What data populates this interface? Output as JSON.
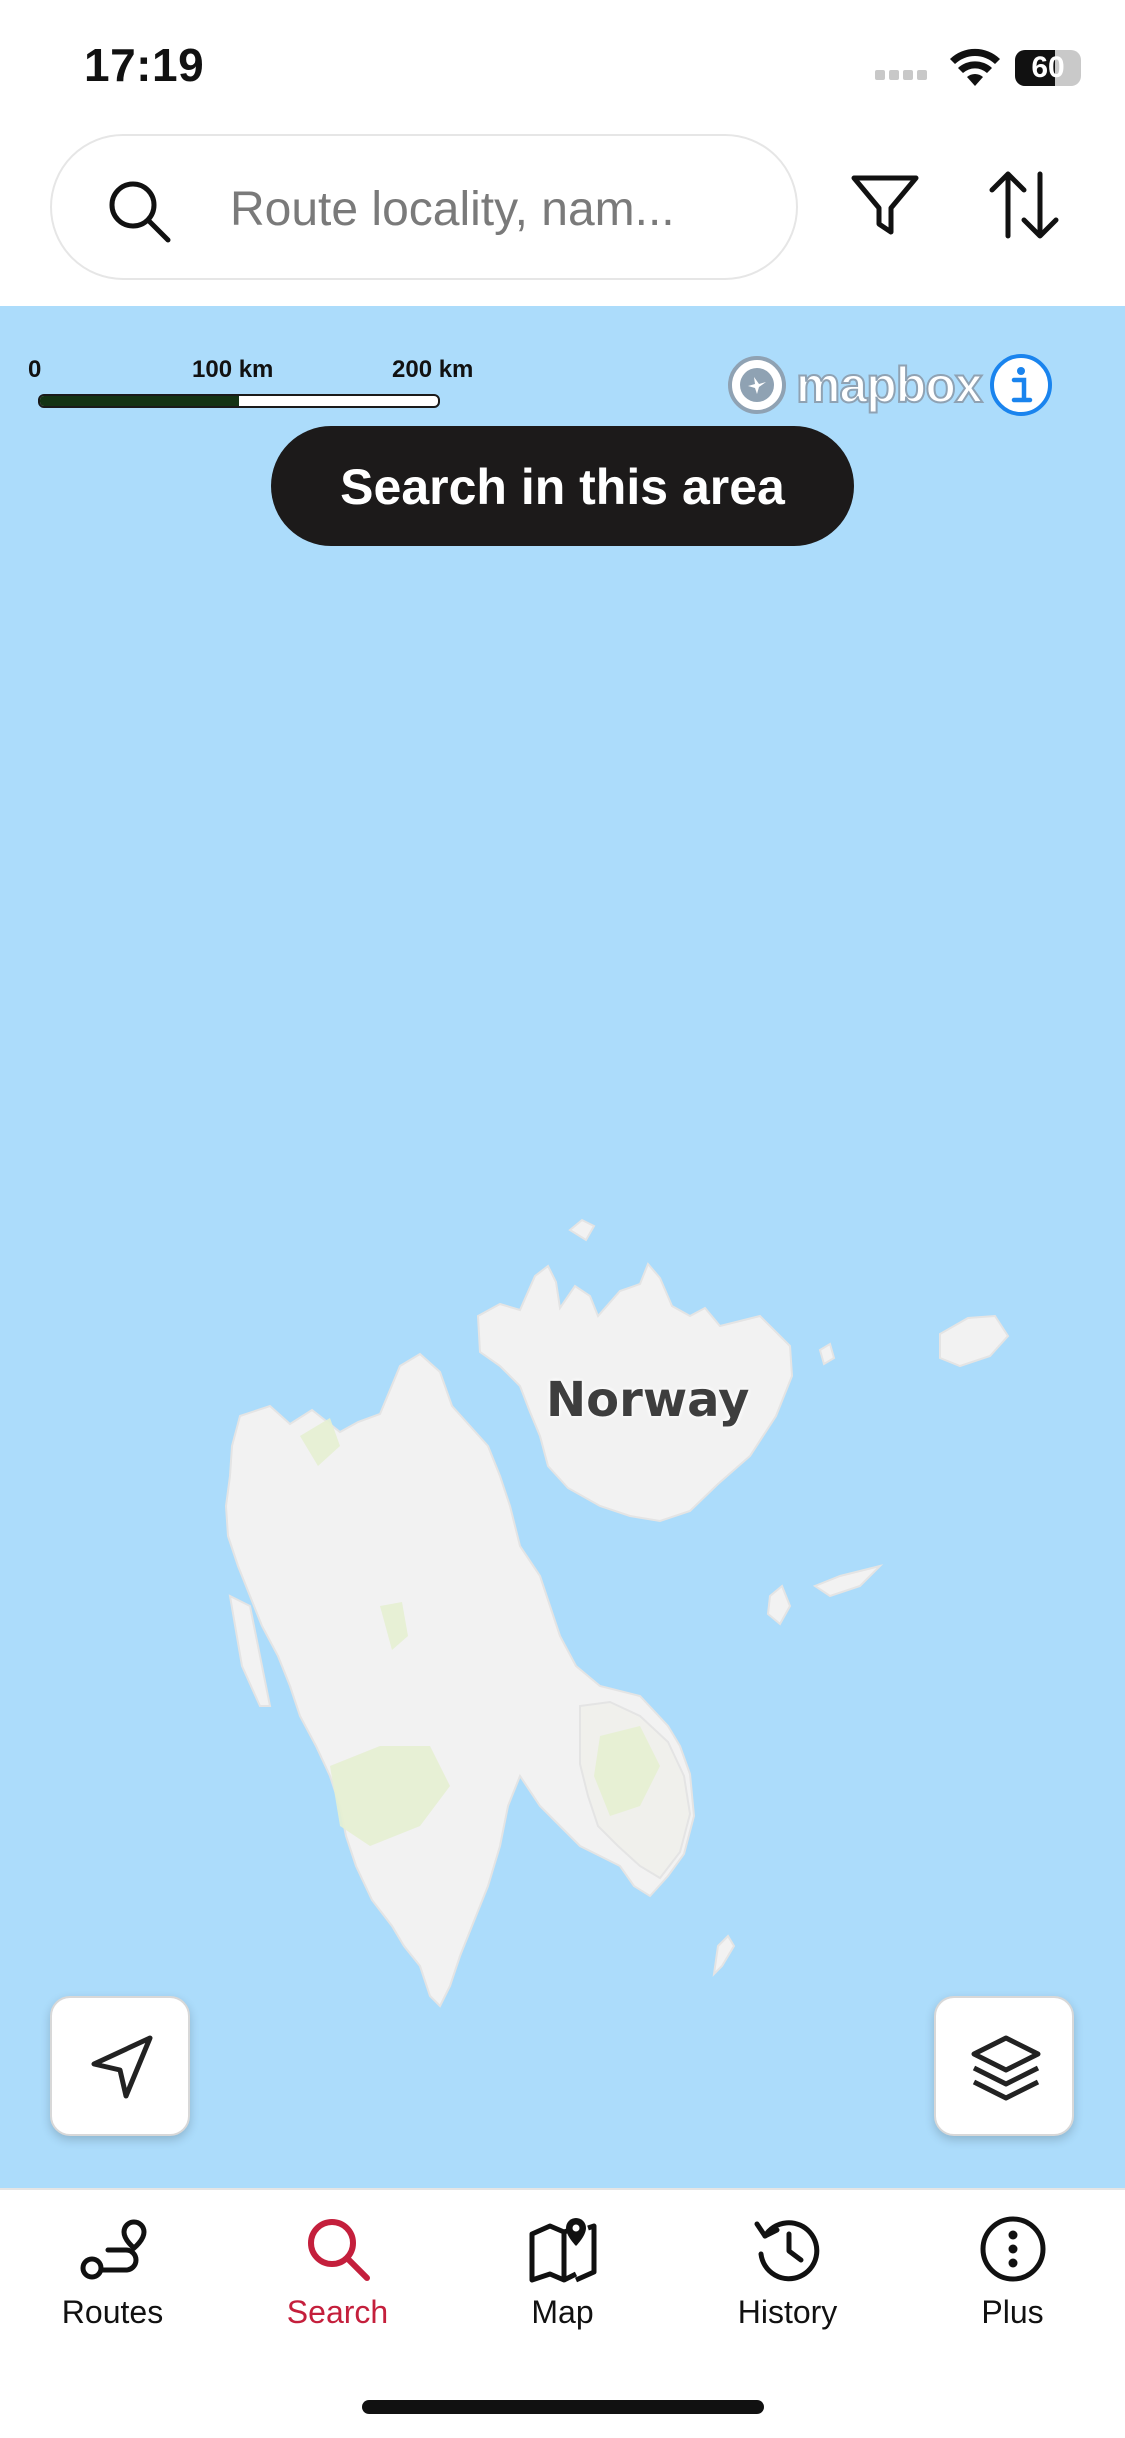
{
  "status_bar": {
    "time": "17:19",
    "battery": "60"
  },
  "search": {
    "placeholder": "Route locality, nam..."
  },
  "map": {
    "scale_labels": [
      "0",
      "100 km",
      "200 km"
    ],
    "attribution": "mapbox",
    "search_area_button": "Search in this area",
    "country_label": "Norway",
    "water_color": "#acdcfb",
    "land_color": "#f2f2f2"
  },
  "nav": {
    "items": [
      {
        "label": "Routes",
        "icon": "route-icon",
        "active": false
      },
      {
        "label": "Search",
        "icon": "search-icon",
        "active": true
      },
      {
        "label": "Map",
        "icon": "map-icon",
        "active": false
      },
      {
        "label": "History",
        "icon": "history-icon",
        "active": false
      },
      {
        "label": "Plus",
        "icon": "more-icon",
        "active": false
      }
    ],
    "active_color": "#c41f3c"
  }
}
